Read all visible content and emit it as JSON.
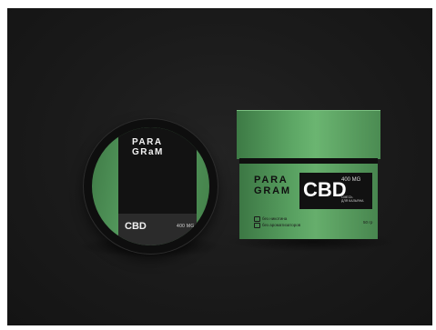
{
  "scene": {
    "background_color": "#1a1a1a",
    "accent_green": "#5aa364"
  },
  "lid": {
    "logo_line1": "PARA",
    "logo_line2": "GRaM",
    "product": "CBD",
    "dose": "400 MG"
  },
  "jar": {
    "logo_line1": "PARA",
    "logo_line2": "GRAM",
    "product": "CBD",
    "dose": "400 MG",
    "subtitle_line1": "СМЕСЬ",
    "subtitle_line2": "ДЛЯ КАЛЬЯНА",
    "features": [
      {
        "icon": "leaf-icon",
        "text": "без никотина"
      },
      {
        "icon": "drop-icon",
        "text": "без ароматизаторов"
      }
    ],
    "weight": "50 гр"
  }
}
